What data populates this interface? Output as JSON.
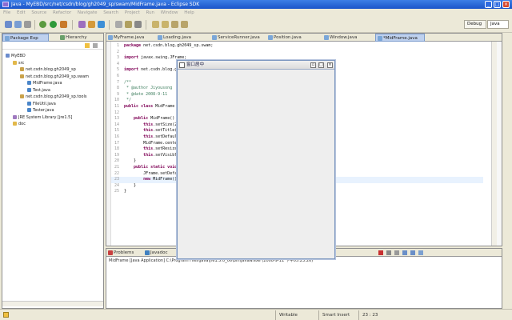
{
  "window": {
    "title": "Java - MyEBD/src/net/csdn/blog/gh2049_sp/swam/MidFrame.java - Eclipse SDK",
    "minimize": "_",
    "maximize": "□",
    "close": "×"
  },
  "menu": [
    "File",
    "Edit",
    "Source",
    "Refactor",
    "Navigate",
    "Search",
    "Project",
    "Run",
    "Window",
    "Help"
  ],
  "perspectives": {
    "debug": "Debug",
    "java": "Java"
  },
  "left_panel": {
    "tabs": [
      "Package Exp",
      "Hierarchy"
    ],
    "tree": [
      {
        "label": "MyEBD",
        "depth": 0,
        "icon": "project-icon"
      },
      {
        "label": "src",
        "depth": 1,
        "icon": "folder-icon"
      },
      {
        "label": "net.csdn.blog.gh2049_sp",
        "depth": 2,
        "icon": "package-icon"
      },
      {
        "label": "net.csdn.blog.gh2049_sp.swam",
        "depth": 2,
        "icon": "package-icon"
      },
      {
        "label": "MidFrame.java",
        "depth": 3,
        "icon": "java-file-icon"
      },
      {
        "label": "Test.java",
        "depth": 3,
        "icon": "java-file-icon"
      },
      {
        "label": "net.csdn.blog.gh2049_sp.tools",
        "depth": 2,
        "icon": "package-icon"
      },
      {
        "label": "FileUtil.java",
        "depth": 3,
        "icon": "java-file-icon"
      },
      {
        "label": "Tester.java",
        "depth": 3,
        "icon": "java-file-icon"
      },
      {
        "label": "JRE System Library [jre1.5]",
        "depth": 1,
        "icon": "library-icon"
      },
      {
        "label": "doc",
        "depth": 1,
        "icon": "folder-icon"
      }
    ]
  },
  "editor": {
    "tabs": [
      {
        "label": "MyFrame.java",
        "active": false
      },
      {
        "label": "Loading.java",
        "active": false
      },
      {
        "label": "ServiceRunner.java",
        "active": false
      },
      {
        "label": "Position.java",
        "active": false
      },
      {
        "label": "Window.java",
        "active": false
      },
      {
        "label": "*MidFrame.java",
        "active": true
      }
    ],
    "lines": [
      {
        "n": "1",
        "parts": [
          {
            "t": "package ",
            "c": "kw"
          },
          {
            "t": "net.csdn.blog.gh2049_sp.swam;",
            "c": ""
          }
        ]
      },
      {
        "n": "2",
        "parts": [
          {
            "t": "",
            "c": ""
          }
        ]
      },
      {
        "n": "3",
        "parts": [
          {
            "t": "import ",
            "c": "kw"
          },
          {
            "t": "javax.swing.JFrame;",
            "c": ""
          }
        ]
      },
      {
        "n": "4",
        "parts": [
          {
            "t": "",
            "c": ""
          }
        ]
      },
      {
        "n": "5",
        "parts": [
          {
            "t": "import ",
            "c": "kw"
          },
          {
            "t": "net.csdn.blog.gh2049_sp.tools.Position;",
            "c": ""
          }
        ]
      },
      {
        "n": "6",
        "parts": [
          {
            "t": "",
            "c": ""
          }
        ]
      },
      {
        "n": "7",
        "parts": [
          {
            "t": "/**",
            "c": "cm"
          }
        ]
      },
      {
        "n": "8",
        "parts": [
          {
            "t": " * @author Jiyousong",
            "c": "cm"
          }
        ]
      },
      {
        "n": "9",
        "parts": [
          {
            "t": " * @date 2008-9-11",
            "c": "cm"
          }
        ]
      },
      {
        "n": "10",
        "parts": [
          {
            "t": " */",
            "c": "cm"
          }
        ]
      },
      {
        "n": "11",
        "parts": [
          {
            "t": "public class ",
            "c": "kw"
          },
          {
            "t": "MidFrame extends JFrame {",
            "c": ""
          }
        ]
      },
      {
        "n": "12",
        "parts": [
          {
            "t": "",
            "c": ""
          }
        ]
      },
      {
        "n": "13",
        "parts": [
          {
            "t": "    public ",
            "c": "kw"
          },
          {
            "t": "MidFrame() {",
            "c": ""
          }
        ]
      },
      {
        "n": "14",
        "parts": [
          {
            "t": "        this",
            "c": "kw"
          },
          {
            "t": ".setSize(200, 250);",
            "c": ""
          }
        ]
      },
      {
        "n": "15",
        "parts": [
          {
            "t": "        this",
            "c": "kw"
          },
          {
            "t": ".setTitle(\"窗口居中\");",
            "c": ""
          }
        ]
      },
      {
        "n": "16",
        "parts": [
          {
            "t": "        this",
            "c": "kw"
          },
          {
            "t": ".setDefaultCloseOperation(EXIT_ON_CLOSE);",
            "c": ""
          }
        ]
      },
      {
        "n": "17",
        "parts": [
          {
            "t": "        MidFrame.center(this);",
            "c": ""
          }
        ]
      },
      {
        "n": "18",
        "parts": [
          {
            "t": "        this",
            "c": "kw"
          },
          {
            "t": ".setResizable(false);",
            "c": ""
          }
        ]
      },
      {
        "n": "19",
        "parts": [
          {
            "t": "        this",
            "c": "kw"
          },
          {
            "t": ".setVisible(true);",
            "c": ""
          }
        ]
      },
      {
        "n": "20",
        "parts": [
          {
            "t": "    }",
            "c": ""
          }
        ]
      },
      {
        "n": "21",
        "parts": [
          {
            "t": "    public static void ",
            "c": "kw"
          },
          {
            "t": "main(String[] args) {",
            "c": ""
          }
        ]
      },
      {
        "n": "22",
        "parts": [
          {
            "t": "        JFrame.setDefaultLookAndFeelDecorated(true);",
            "c": ""
          }
        ]
      },
      {
        "n": "23",
        "parts": [
          {
            "t": "        new ",
            "c": "kw"
          },
          {
            "t": "MidFrame();",
            "c": ""
          }
        ]
      },
      {
        "n": "24",
        "parts": [
          {
            "t": "    }",
            "c": ""
          }
        ]
      },
      {
        "n": "25",
        "parts": [
          {
            "t": "}",
            "c": ""
          }
        ]
      }
    ]
  },
  "floating_window": {
    "title": "窗口居中",
    "restore": "▫",
    "maximize": "□",
    "close": "×"
  },
  "bottom_panel": {
    "tabs": [
      "Problems",
      "Javadoc",
      "Declaration",
      "Console"
    ],
    "console_header": "MidFrame [Java Application] C:\\Program Files\\Java\\jre1.5.0_06\\bin\\javaw.exe (2008-9-11 下午05:23:26)"
  },
  "status": {
    "writable": "Writable",
    "insert_mode": "Smart Insert",
    "position": "23 : 23"
  },
  "colors": {
    "titlebar": "#1b55c9",
    "active_tab": "#bfd1ee",
    "keyword": "#7f0055",
    "comment": "#3f7f5f"
  }
}
